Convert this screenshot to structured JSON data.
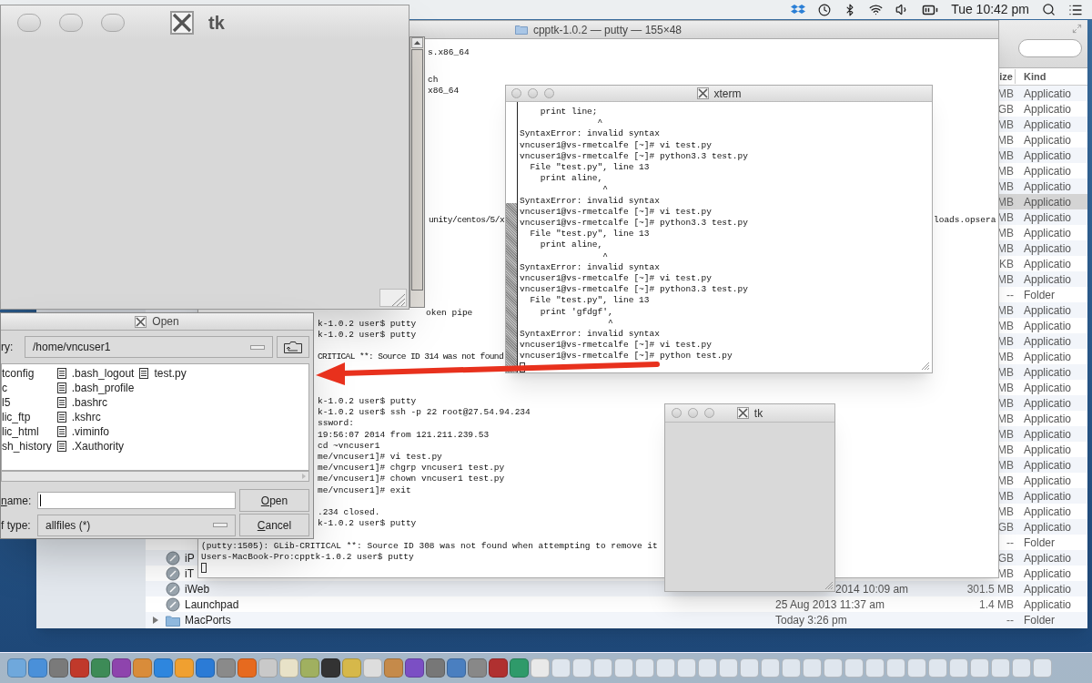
{
  "menubar": {
    "clock": "Tue 10:42 pm"
  },
  "finder": {
    "columns": [
      "ize",
      "Kind"
    ],
    "rows": [
      {
        "size": "MB",
        "kind_label": "Applicatio",
        "selected": false
      },
      {
        "size": "GB",
        "kind_label": "Applicatio",
        "selected": false
      },
      {
        "size": "MB",
        "kind_label": "Applicatio",
        "selected": false
      },
      {
        "size": "MB",
        "kind_label": "Applicatio",
        "selected": false
      },
      {
        "size": "MB",
        "kind_label": "Applicatio",
        "selected": false
      },
      {
        "size": "MB",
        "kind_label": "Applicatio",
        "selected": false
      },
      {
        "size": "MB",
        "kind_label": "Applicatio",
        "selected": false
      },
      {
        "size": "MB",
        "kind_label": "Applicatio",
        "selected": true
      },
      {
        "size": "MB",
        "kind_label": "Applicatio",
        "selected": false
      },
      {
        "size": "MB",
        "kind_label": "Applicatio",
        "selected": false
      },
      {
        "size": "MB",
        "kind_label": "Applicatio",
        "selected": false
      },
      {
        "size": "KB",
        "kind_label": "Applicatio",
        "selected": false
      },
      {
        "size": "MB",
        "kind_label": "Applicatio",
        "selected": false
      },
      {
        "size": "--",
        "kind_label": "Folder",
        "selected": false
      },
      {
        "size": "MB",
        "kind_label": "Applicatio",
        "selected": false
      },
      {
        "size": "MB",
        "kind_label": "Applicatio",
        "selected": false
      },
      {
        "size": "MB",
        "kind_label": "Applicatio",
        "selected": false
      },
      {
        "size": "MB",
        "kind_label": "Applicatio",
        "selected": false
      },
      {
        "size": "MB",
        "kind_label": "Applicatio",
        "selected": false
      },
      {
        "size": "MB",
        "kind_label": "Applicatio",
        "selected": false
      },
      {
        "size": "MB",
        "kind_label": "Applicatio",
        "selected": false
      },
      {
        "size": "MB",
        "kind_label": "Applicatio",
        "selected": false
      },
      {
        "size": "MB",
        "kind_label": "Applicatio",
        "selected": false
      },
      {
        "size": "MB",
        "kind_label": "Applicatio",
        "selected": false
      },
      {
        "size": "MB",
        "kind_label": "Applicatio",
        "selected": false
      },
      {
        "size": "MB",
        "kind_label": "Applicatio",
        "selected": false
      },
      {
        "size": "MB",
        "kind_label": "Applicatio",
        "selected": false
      },
      {
        "size": "MB",
        "kind_label": "Applicatio",
        "selected": false
      },
      {
        "size": "GB",
        "kind_label": "Applicatio",
        "selected": false
      },
      {
        "size": "--",
        "kind_label": "Folder",
        "selected": false
      },
      {
        "name": "iP",
        "size": "GB",
        "kind_label": "Applicatio",
        "kind": "app",
        "selected": false
      },
      {
        "name": "iT",
        "size": "MB",
        "kind_label": "Applicatio",
        "kind": "app",
        "selected": false
      },
      {
        "name": "iWeb",
        "date": "2014 10:09 am",
        "date_cut": true,
        "size": "301.5 MB",
        "kind_label": "Applicatio",
        "kind": "app",
        "selected": false
      },
      {
        "name": "Launchpad",
        "date": "25 Aug 2013 11:37 am",
        "date_cut": false,
        "size": "1.4 MB",
        "kind_label": "Applicatio",
        "kind": "app",
        "selected": false
      },
      {
        "name": "MacPorts",
        "date": "Today 3:26 pm",
        "date_cut": false,
        "size": "--",
        "kind_label": "Folder",
        "kind": "folder",
        "expanded": false,
        "selected": false
      }
    ]
  },
  "putty": {
    "title": "cpptk-1.0.2 — putty — 155×48",
    "blocks": [
      {
        "lines": [
          "s.x86_64"
        ]
      },
      {
        "lines": [
          "ch",
          "x86_64"
        ]
      },
      {
        "lines": [
          "unity/centos/5/x"
        ]
      },
      {
        "lines": [
          "loads.opsera"
        ]
      },
      {
        "lines": [
          "oken pipe"
        ]
      },
      {
        "lines": [
          "k-1.0.2 user$ putty",
          "k-1.0.2 user$ putty"
        ]
      },
      {
        "lines": [
          "CRITICAL **: Source ID 314 was not found"
        ]
      },
      {
        "lines": [
          "k-1.0.2 user$ putty",
          "k-1.0.2 user$ ssh -p 22 root@27.54.94.234",
          "ssword:",
          "19:56:07 2014 from 121.211.239.53",
          "cd ~vncuser1",
          "me/vncuser1]# vi test.py",
          "me/vncuser1]# chgrp vncuser1 test.py",
          "me/vncuser1]# chown vncuser1 test.py",
          "me/vncuser1]# exit"
        ]
      },
      {
        "lines": [
          ".234 closed.",
          "k-1.0.2 user$ putty"
        ]
      },
      {
        "lines": [
          "(putty:1505): GLib-CRITICAL **: Source ID 308 was not found when attempting to remove it",
          "Users-MacBook-Pro:cpptk-1.0.2 user$ putty"
        ],
        "cursor": true
      }
    ]
  },
  "xterm": {
    "title": "xterm",
    "lines": [
      "    print line;",
      "               ^",
      "SyntaxError: invalid syntax",
      "vncuser1@vs-rmetcalfe [~]# vi test.py",
      "vncuser1@vs-rmetcalfe [~]# python3.3 test.py",
      "  File \"test.py\", line 13",
      "    print aline,",
      "                ^",
      "SyntaxError: invalid syntax",
      "vncuser1@vs-rmetcalfe [~]# vi test.py",
      "vncuser1@vs-rmetcalfe [~]# python3.3 test.py",
      "  File \"test.py\", line 13",
      "    print aline,",
      "                ^",
      "SyntaxError: invalid syntax",
      "vncuser1@vs-rmetcalfe [~]# vi test.py",
      "vncuser1@vs-rmetcalfe [~]# python3.3 test.py",
      "  File \"test.py\", line 13",
      "    print 'gfdgf',",
      "                 ^",
      "SyntaxError: invalid syntax",
      "vncuser1@vs-rmetcalfe [~]# vi test.py",
      "vncuser1@vs-rmetcalfe [~]# python test.py"
    ],
    "cursor": true
  },
  "tk_window": {
    "title": "tk"
  },
  "open_dialog": {
    "title": "Open",
    "directory_label": "ry:",
    "directory": "/home/vncuser1",
    "file_columns": [
      {
        "items": [
          "tconfig",
          "c",
          "l5",
          "lic_ftp",
          "lic_html",
          "sh_history"
        ]
      },
      {
        "icons": true,
        "items": [
          ".bash_logout",
          ".bash_profile",
          ".bashrc",
          ".kshrc",
          ".viminfo",
          ".Xauthority"
        ]
      },
      {
        "icons": true,
        "items": [
          "test.py"
        ]
      }
    ],
    "filename_label": "name:",
    "type_label": "f type:",
    "file_type": "allfiles (*)",
    "buttons": [
      "Open",
      "Cancel"
    ]
  },
  "small_tk_window": {
    "title": "tk"
  }
}
